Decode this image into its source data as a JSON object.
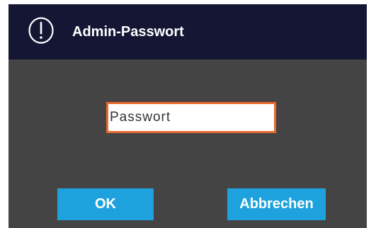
{
  "dialog": {
    "title": "Admin-Passwort",
    "icon": "alert-circle-icon",
    "colors": {
      "titlebar": "#141633",
      "body": "#454444",
      "input_border": "#e8692e",
      "button": "#1da2dd"
    }
  },
  "password": {
    "placeholder": "Passwort",
    "value": ""
  },
  "buttons": {
    "ok_label": "OK",
    "cancel_label": "Abbrechen"
  }
}
